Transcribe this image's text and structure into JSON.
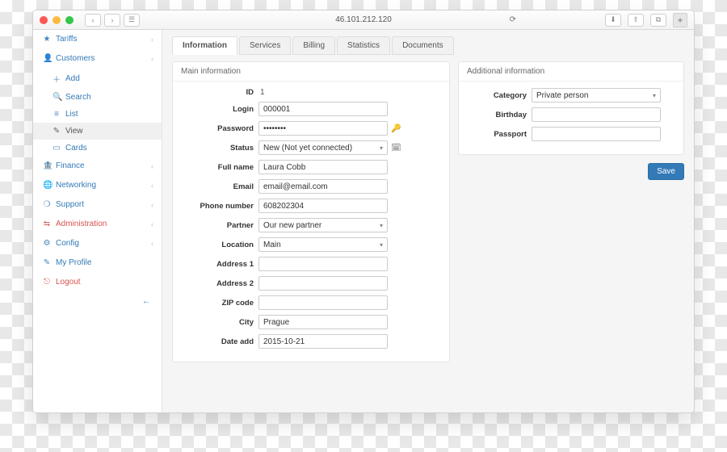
{
  "browser": {
    "url": "46.101.212.120"
  },
  "sidebar": {
    "tariffs": "Tariffs",
    "customers": "Customers",
    "add": "Add",
    "search": "Search",
    "list": "List",
    "view": "View",
    "cards": "Cards",
    "finance": "Finance",
    "networking": "Networking",
    "support": "Support",
    "administration": "Administration",
    "config": "Config",
    "my_profile": "My Profile",
    "logout": "Logout"
  },
  "tabs": {
    "information": "Information",
    "services": "Services",
    "billing": "Billing",
    "statistics": "Statistics",
    "documents": "Documents"
  },
  "panels": {
    "main_title": "Main information",
    "additional_title": "Additional information"
  },
  "labels": {
    "id": "ID",
    "login": "Login",
    "password": "Password",
    "status": "Status",
    "full_name": "Full name",
    "email": "Email",
    "phone": "Phone number",
    "partner": "Partner",
    "location": "Location",
    "address1": "Address 1",
    "address2": "Address 2",
    "zip": "ZIP code",
    "city": "City",
    "date_add": "Date add",
    "category": "Category",
    "birthday": "Birthday",
    "passport": "Passport"
  },
  "values": {
    "id": "1",
    "login": "000001",
    "password_masked": "••••••••",
    "status": "New (Not yet connected)",
    "full_name": "Laura Cobb",
    "email": "email@email.com",
    "phone": "608202304",
    "partner": "Our new partner",
    "location": "Main",
    "address1": "",
    "address2": "",
    "zip": "",
    "city": "Prague",
    "date_add": "2015-10-21",
    "category": "Private person",
    "birthday": "",
    "passport": ""
  },
  "buttons": {
    "save": "Save"
  }
}
